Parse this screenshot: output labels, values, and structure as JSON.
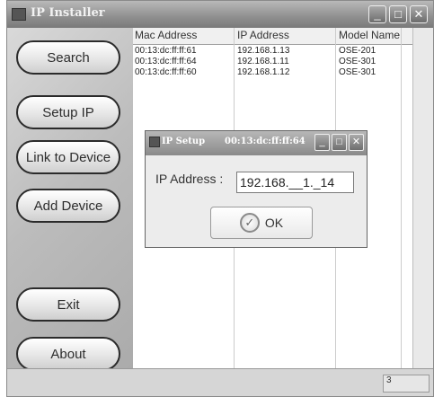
{
  "window": {
    "title": "IP Installer"
  },
  "sidebar": {
    "buttons": [
      {
        "label": "Search"
      },
      {
        "label": "Setup IP"
      },
      {
        "label": "Link to Device"
      },
      {
        "label": "Add Device"
      },
      {
        "label": "Exit"
      },
      {
        "label": "About"
      }
    ]
  },
  "table": {
    "columns": [
      "Mac Address",
      "IP Address",
      "Model Name"
    ],
    "rows": [
      [
        "00:13:dc:ff:ff:61",
        "192.168.1.13",
        "OSE-201"
      ],
      [
        "00:13:dc:ff:ff:64",
        "192.168.1.11",
        "OSE-301"
      ],
      [
        "00:13:dc:ff:ff:60",
        "192.168.1.12",
        "OSE-301"
      ]
    ]
  },
  "status": {
    "count": "3"
  },
  "dialog": {
    "title": "IP Setup",
    "mac": "00:13:dc:ff:ff:64",
    "ip_label": "IP Address :",
    "ip_value": "192.168.__1._14",
    "ok_label": "OK"
  }
}
